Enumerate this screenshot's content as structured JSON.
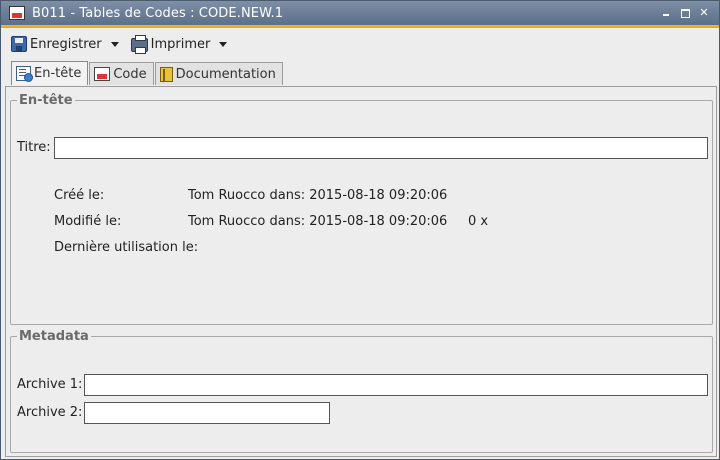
{
  "window": {
    "title": "B011 - Tables de Codes : CODE.NEW.1"
  },
  "toolbar": {
    "save_label": "Enregistrer",
    "print_label": "Imprimer"
  },
  "tabs": [
    {
      "label": "En-tête",
      "icon": "document-info-icon",
      "active": true
    },
    {
      "label": "Code",
      "icon": "code-table-icon",
      "active": false
    },
    {
      "label": "Documentation",
      "icon": "book-icon",
      "active": false
    }
  ],
  "header_group": {
    "legend": "En-tête",
    "title_label": "Titre:",
    "title_value": "",
    "created_label": "Créé le:",
    "created_value": "Tom Ruocco dans: 2015-08-18 09:20:06",
    "modified_label": "Modifié le:",
    "modified_value": "Tom Ruocco dans: 2015-08-18 09:20:06",
    "modified_count": "0 x",
    "last_used_label": "Dernière utilisation le:",
    "last_used_value": ""
  },
  "metadata_group": {
    "legend": "Metadata",
    "archive1_label": "Archive 1:",
    "archive1_value": "",
    "archive2_label": "Archive 2:",
    "archive2_value": ""
  },
  "colors": {
    "titlebar": "#6a7d96",
    "accent": "#eeae17",
    "background": "#ededed"
  }
}
